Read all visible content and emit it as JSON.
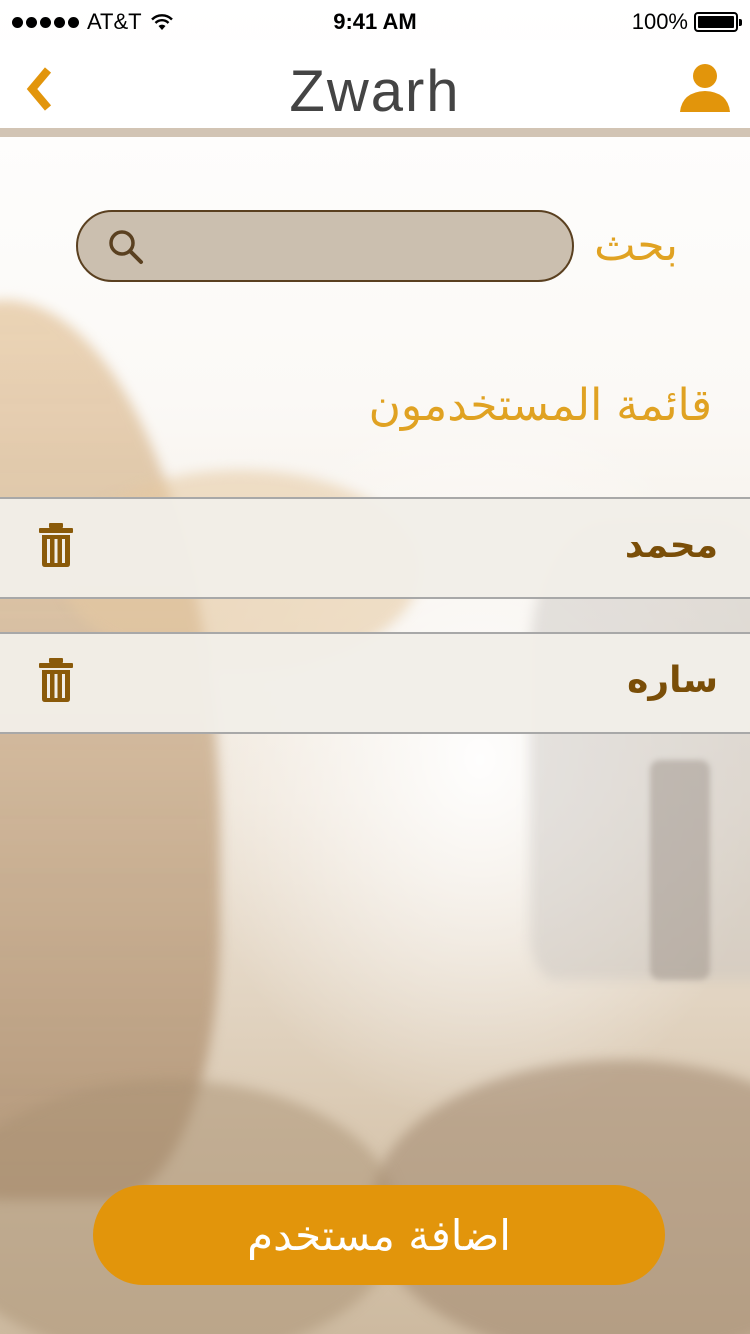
{
  "status_bar": {
    "carrier": "AT&T",
    "time": "9:41 AM",
    "battery": "100%"
  },
  "nav": {
    "title": "Zwarh",
    "back_icon": "chevron-left-icon",
    "profile_icon": "user-icon"
  },
  "search": {
    "label": "بحث",
    "placeholder": "",
    "icon": "search-icon"
  },
  "users_list": {
    "title": "قائمة المستخدمون",
    "items": [
      {
        "name": "محمد",
        "delete_icon": "trash-icon"
      },
      {
        "name": "ساره",
        "delete_icon": "trash-icon"
      }
    ]
  },
  "add_button": {
    "label": "اضافة مستخدم"
  },
  "colors": {
    "accent": "#e2950b",
    "title_gold": "#e0a222",
    "name_brown": "#7a4e08",
    "search_bg": "#cbbfaf",
    "nav_border": "#d2c4b4"
  }
}
